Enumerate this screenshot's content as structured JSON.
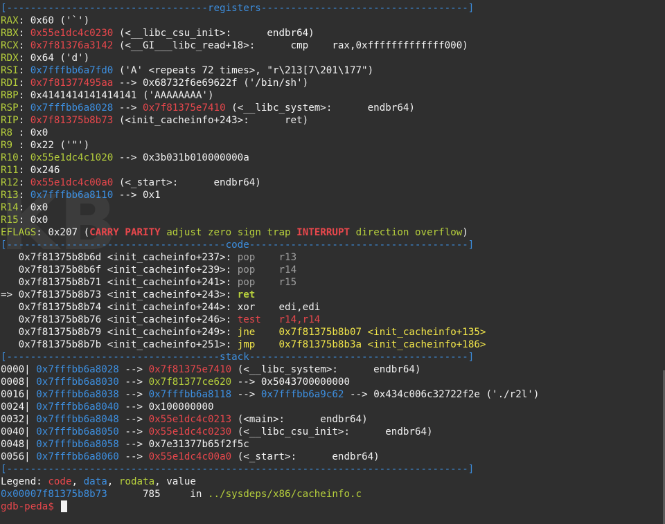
{
  "colors": {
    "code": "#e8474c",
    "data": "#3d8fe0",
    "rodata": "#b6cf3c",
    "value": "#f2f2f2",
    "bg": "#2f2f2f"
  },
  "registers": {
    "header": "[----------------------------------registers-----------------------------------]",
    "items": [
      {
        "name": "RAX",
        "addr": "",
        "rest": "0x60 ('`')",
        "addr_color": "white"
      },
      {
        "name": "RBX",
        "addr": "0x55e1dc4c0230",
        "rest": " (<__libc_csu_init>:\tendbr64)",
        "addr_color": "red"
      },
      {
        "name": "RCX",
        "addr": "0x7f81376a3142",
        "rest": " (<__GI___libc_read+18>:\tcmp    rax,0xfffffffffffff000)",
        "addr_color": "red"
      },
      {
        "name": "RDX",
        "addr": "",
        "rest": "0x64 ('d')",
        "addr_color": "white"
      },
      {
        "name": "RSI",
        "addr": "0x7fffbb6a7fd0",
        "rest": " ('A' <repeats 72 times>, \"r\\213[7\\201\\177\")",
        "addr_color": "blue"
      },
      {
        "name": "RDI",
        "addr": "0x7f81377495aa",
        "rest": " --> 0x68732f6e69622f ('/bin/sh')",
        "addr_color": "red"
      },
      {
        "name": "RBP",
        "addr": "",
        "rest": "0x4141414141414141 ('AAAAAAAA')",
        "addr_color": "white"
      },
      {
        "name": "RSP",
        "addr": "0x7fffbb6a8028",
        "rest": " --> ",
        "addr2": "0x7f81375e7410",
        "rest2": " (<__libc_system>:\tendbr64)",
        "addr_color": "blue"
      },
      {
        "name": "RIP",
        "addr": "0x7f81375b8b73",
        "rest": " (<init_cacheinfo+243>:\tret)",
        "addr_color": "red"
      },
      {
        "name": "R8 ",
        "addr": "",
        "rest": "0x0",
        "addr_color": "white"
      },
      {
        "name": "R9 ",
        "addr": "",
        "rest": "0x22 ('\"')",
        "addr_color": "white"
      },
      {
        "name": "R10",
        "addr": "0x55e1dc4c1020",
        "rest": " --> 0x3b031b010000000a",
        "addr_color": "green"
      },
      {
        "name": "R11",
        "addr": "",
        "rest": "0x246",
        "addr_color": "white"
      },
      {
        "name": "R12",
        "addr": "0x55e1dc4c00a0",
        "rest": " (<_start>:\tendbr64)",
        "addr_color": "red"
      },
      {
        "name": "R13",
        "addr": "0x7fffbb6a8110",
        "rest": " --> 0x1",
        "addr_color": "blue"
      },
      {
        "name": "R14",
        "addr": "",
        "rest": "0x0",
        "addr_color": "white"
      },
      {
        "name": "R15",
        "addr": "",
        "rest": "0x0",
        "addr_color": "white"
      }
    ],
    "eflags": {
      "label": "EFLAGS",
      "value": "0x207 (",
      "flags": [
        {
          "t": "CARRY",
          "on": true
        },
        {
          "t": "PARITY",
          "on": true
        },
        {
          "t": "adjust",
          "on": false
        },
        {
          "t": "zero",
          "on": false
        },
        {
          "t": "sign",
          "on": false
        },
        {
          "t": "trap",
          "on": false
        },
        {
          "t": "INTERRUPT",
          "on": true
        },
        {
          "t": "direction",
          "on": false
        },
        {
          "t": "overflow",
          "on": false
        }
      ],
      "close": ")"
    }
  },
  "code": {
    "header": "[-------------------------------------code-------------------------------------]",
    "lines": [
      {
        "marker": "   ",
        "addr": "0x7f81375b8b6d",
        "sym": "<init_cacheinfo+237>:",
        "op": "pop",
        "args": "r13",
        "style": "gray"
      },
      {
        "marker": "   ",
        "addr": "0x7f81375b8b6f",
        "sym": "<init_cacheinfo+239>:",
        "op": "pop",
        "args": "r14",
        "style": "gray"
      },
      {
        "marker": "   ",
        "addr": "0x7f81375b8b71",
        "sym": "<init_cacheinfo+241>:",
        "op": "pop",
        "args": "r15",
        "style": "gray"
      },
      {
        "marker": "=> ",
        "addr": "0x7f81375b8b73",
        "sym": "<init_cacheinfo+243>:",
        "op": "ret",
        "args": "",
        "style": "current"
      },
      {
        "marker": "   ",
        "addr": "0x7f81375b8b74",
        "sym": "<init_cacheinfo+244>:",
        "op": "xor",
        "args": "edi,edi",
        "style": "white"
      },
      {
        "marker": "   ",
        "addr": "0x7f81375b8b76",
        "sym": "<init_cacheinfo+246>:",
        "op": "test",
        "args": "r14,r14",
        "style": "red"
      },
      {
        "marker": "   ",
        "addr": "0x7f81375b8b79",
        "sym": "<init_cacheinfo+249>:",
        "op": "jne",
        "args": "0x7f81375b8b07 <init_cacheinfo+135>",
        "style": "yellow"
      },
      {
        "marker": "   ",
        "addr": "0x7f81375b8b7b",
        "sym": "<init_cacheinfo+251>:",
        "op": "jmp",
        "args": "0x7f81375b8b3a <init_cacheinfo+186>",
        "style": "yellow"
      }
    ]
  },
  "stack": {
    "header": "[------------------------------------stack-------------------------------------]",
    "rows": [
      {
        "off": "0000|",
        "addr": "0x7fffbb6a8028",
        "chain": [
          {
            "t": " --> ",
            "c": "white"
          },
          {
            "t": "0x7f81375e7410",
            "c": "red"
          },
          {
            "t": " (<__libc_system>:\tendbr64)",
            "c": "white"
          }
        ]
      },
      {
        "off": "0008|",
        "addr": "0x7fffbb6a8030",
        "chain": [
          {
            "t": " --> ",
            "c": "white"
          },
          {
            "t": "0x7f81377ce620",
            "c": "green"
          },
          {
            "t": " --> 0x5043700000000",
            "c": "white"
          }
        ]
      },
      {
        "off": "0016|",
        "addr": "0x7fffbb6a8038",
        "chain": [
          {
            "t": " --> ",
            "c": "white"
          },
          {
            "t": "0x7fffbb6a8118",
            "c": "blue"
          },
          {
            "t": " --> ",
            "c": "white"
          },
          {
            "t": "0x7fffbb6a9c62",
            "c": "blue"
          },
          {
            "t": " --> 0x434c006c32722f2e ('./r2l')",
            "c": "white"
          }
        ]
      },
      {
        "off": "0024|",
        "addr": "0x7fffbb6a8040",
        "chain": [
          {
            "t": " --> 0x100000000",
            "c": "white"
          }
        ]
      },
      {
        "off": "0032|",
        "addr": "0x7fffbb6a8048",
        "chain": [
          {
            "t": " --> ",
            "c": "white"
          },
          {
            "t": "0x55e1dc4c0213",
            "c": "red"
          },
          {
            "t": " (<main>:\tendbr64)",
            "c": "white"
          }
        ]
      },
      {
        "off": "0040|",
        "addr": "0x7fffbb6a8050",
        "chain": [
          {
            "t": " --> ",
            "c": "white"
          },
          {
            "t": "0x55e1dc4c0230",
            "c": "red"
          },
          {
            "t": " (<__libc_csu_init>:\tendbr64)",
            "c": "white"
          }
        ]
      },
      {
        "off": "0048|",
        "addr": "0x7fffbb6a8058",
        "chain": [
          {
            "t": " --> 0x7e31377b65f2f5c",
            "c": "white"
          }
        ]
      },
      {
        "off": "0056|",
        "addr": "0x7fffbb6a8060",
        "chain": [
          {
            "t": " --> ",
            "c": "white"
          },
          {
            "t": "0x55e1dc4c00a0",
            "c": "red"
          },
          {
            "t": " (<_start>:\tendbr64)",
            "c": "white"
          }
        ]
      }
    ],
    "footer": "[------------------------------------------------------------------------------]"
  },
  "legend": {
    "label": "Legend: ",
    "code": "code",
    "data": "data",
    "rodata": "rodata",
    "value": "value",
    "sep": ", "
  },
  "location": {
    "addr": "0x00007f81375b8b73",
    "line": "785",
    "in": "in",
    "file": "../sysdeps/x86/cacheinfo.c"
  },
  "prompt": "gdb-peda$ "
}
